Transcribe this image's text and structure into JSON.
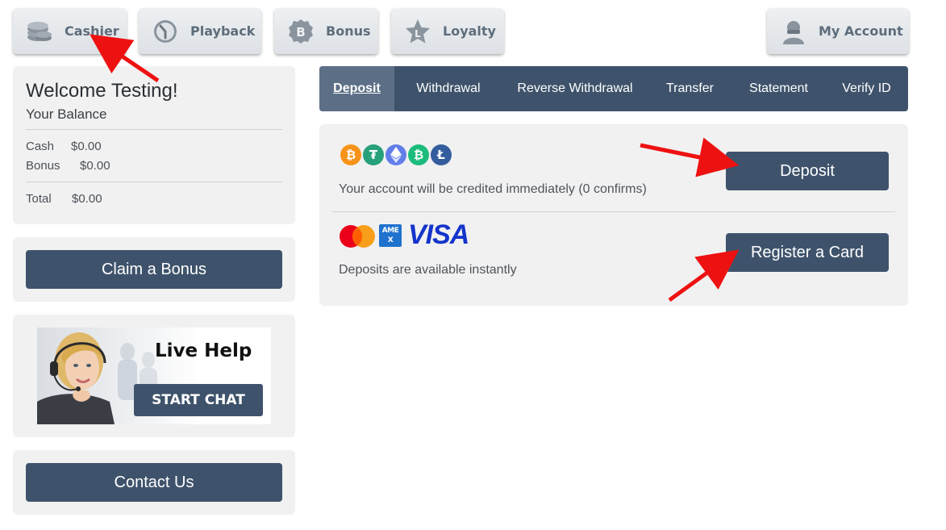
{
  "nav": {
    "cashier": "Cashier",
    "playback": "Playback",
    "bonus": "Bonus",
    "loyalty": "Loyalty",
    "my_account": "My Account"
  },
  "welcome": {
    "title": "Welcome Testing!",
    "balance_label": "Your Balance",
    "cash_label": "Cash",
    "cash_value": "$0.00",
    "bonus_label": "Bonus",
    "bonus_value": "$0.00",
    "total_label": "Total",
    "total_value": "$0.00"
  },
  "claim_bonus": "Claim a Bonus",
  "live_help": {
    "title": "Live Help",
    "button": "START CHAT"
  },
  "contact_us": "Contact Us",
  "tabs": [
    "Deposit",
    "Withdrawal",
    "Reverse Withdrawal",
    "Transfer",
    "Statement",
    "Verify ID"
  ],
  "crypto": {
    "coins": [
      "bitcoin-icon",
      "tether-icon",
      "ethereum-icon",
      "bitcoin-cash-icon",
      "litecoin-icon"
    ],
    "description": "Your account will be credited immediately (0 confirms)",
    "button": "Deposit"
  },
  "card": {
    "brands": [
      "mastercard-icon",
      "amex-icon",
      "visa-icon"
    ],
    "amex_text": "AMEX",
    "visa_text": "VISA",
    "description": "Deposits are available instantly",
    "button": "Register a Card"
  },
  "colors": {
    "primary": "#3e536b",
    "active_tab": "#5c6f86",
    "panel": "#f1f1f1",
    "annotation_arrow": "#ee1111"
  }
}
